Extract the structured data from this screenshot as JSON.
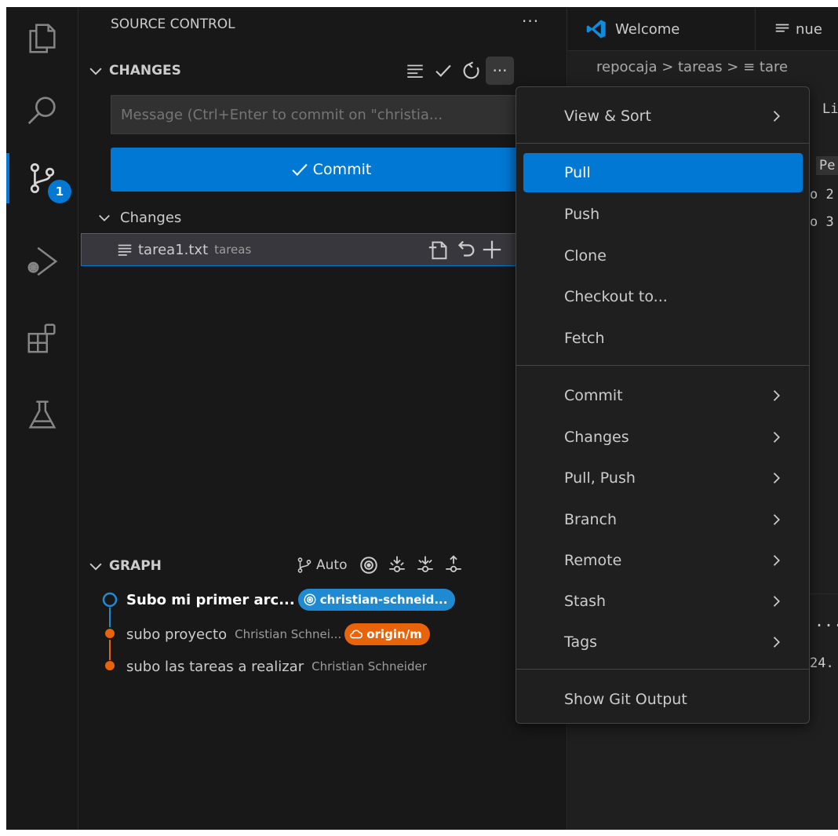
{
  "sidebar": {
    "title": "SOURCE CONTROL",
    "more": "···",
    "changes_section": {
      "label": "CHANGES",
      "more": "···"
    },
    "message_placeholder": "Message (Ctrl+Enter to commit on \"christia...",
    "commit_label": "Commit",
    "changes_group_label": "Changes",
    "file": {
      "name": "tarea1.txt",
      "dir": "tareas"
    },
    "graph": {
      "label": "GRAPH",
      "auto_label": "Auto",
      "commits": [
        {
          "message": "Subo mi primer arc...",
          "badge": "christian-schneid...",
          "badge_color": "#1f8ad2"
        },
        {
          "message": "subo proyecto",
          "author": "Christian Schnei...",
          "badge": "origin/m",
          "badge_color": "#e8630a"
        },
        {
          "message": "subo las tareas a realizar",
          "author": "Christian Schneider"
        }
      ]
    }
  },
  "activity_bar": {
    "badge_count": "1"
  },
  "editor": {
    "tabs": [
      {
        "label": "Welcome"
      },
      {
        "label": "nue"
      }
    ],
    "breadcrumb": "repocaja > tareas > ≡ tare",
    "fragments": {
      "li": "Li",
      "pe": "Pe",
      "o2": "o 2",
      "o3": "o 3",
      "dots": "...",
      "num": "24."
    }
  },
  "menu": {
    "items": [
      {
        "label": "View & Sort",
        "submenu": true
      },
      {
        "label": "Pull",
        "selected": true
      },
      {
        "label": "Push"
      },
      {
        "label": "Clone"
      },
      {
        "label": "Checkout to..."
      },
      {
        "label": "Fetch"
      },
      {
        "label": "Commit",
        "submenu": true
      },
      {
        "label": "Changes",
        "submenu": true
      },
      {
        "label": "Pull, Push",
        "submenu": true
      },
      {
        "label": "Branch",
        "submenu": true
      },
      {
        "label": "Remote",
        "submenu": true
      },
      {
        "label": "Stash",
        "submenu": true
      },
      {
        "label": "Tags",
        "submenu": true
      },
      {
        "label": "Show Git Output"
      }
    ]
  },
  "colors": {
    "accent": "#0078d4",
    "local_branch": "#1f8ad2",
    "remote_branch": "#e8630a"
  }
}
